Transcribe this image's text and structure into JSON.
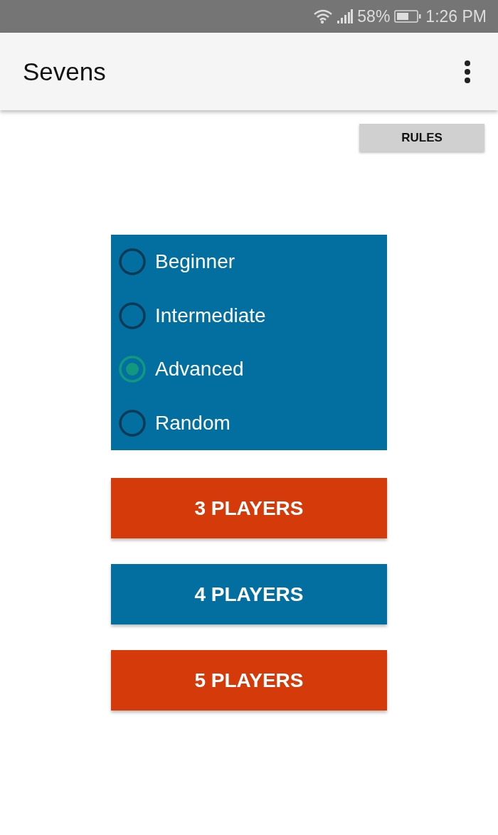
{
  "status_bar": {
    "battery": "58%",
    "time": "1:26 PM"
  },
  "app_bar": {
    "title": "Sevens"
  },
  "rules_button": "RULES",
  "difficulty": [
    {
      "label": "Beginner",
      "selected": false
    },
    {
      "label": "Intermediate",
      "selected": false
    },
    {
      "label": "Advanced",
      "selected": true
    },
    {
      "label": "Random",
      "selected": false
    }
  ],
  "player_buttons": [
    {
      "label": "3 PLAYERS",
      "color": "#d53a0a"
    },
    {
      "label": "4 PLAYERS",
      "color": "#036fa0"
    },
    {
      "label": "5 PLAYERS",
      "color": "#d53a0a"
    }
  ]
}
